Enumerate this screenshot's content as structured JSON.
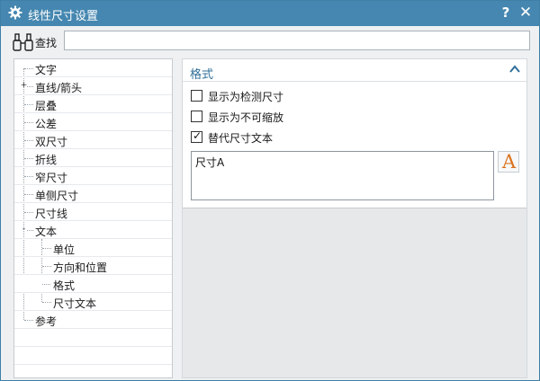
{
  "window": {
    "title": "线性尺寸设置",
    "help_label": "?",
    "close_label": "✕"
  },
  "search": {
    "label": "查找",
    "value": "",
    "placeholder": ""
  },
  "tree": {
    "items": [
      {
        "label": "文字",
        "level": 0
      },
      {
        "label": "直线/箭头",
        "level": 0,
        "expander": "+"
      },
      {
        "label": "层叠",
        "level": 0
      },
      {
        "label": "公差",
        "level": 0
      },
      {
        "label": "双尺寸",
        "level": 0
      },
      {
        "label": "折线",
        "level": 0
      },
      {
        "label": "窄尺寸",
        "level": 0
      },
      {
        "label": "单侧尺寸",
        "level": 0
      },
      {
        "label": "尺寸线",
        "level": 0
      },
      {
        "label": "文本",
        "level": 0,
        "expander": "-"
      },
      {
        "label": "单位",
        "level": 1
      },
      {
        "label": "方向和位置",
        "level": 1
      },
      {
        "label": "格式",
        "level": 1,
        "selected": true
      },
      {
        "label": "尺寸文本",
        "level": 1
      },
      {
        "label": "参考",
        "level": 0
      }
    ]
  },
  "format_group": {
    "title": "格式",
    "options": [
      {
        "label": "显示为检测尺寸",
        "checked": false
      },
      {
        "label": "显示为不可缩放",
        "checked": false
      },
      {
        "label": "替代尺寸文本",
        "checked": true
      }
    ],
    "override_text": "尺寸A",
    "font_button_glyph": "A"
  },
  "colors": {
    "titlebar": "#4587b0",
    "selection": "#a9cbdc",
    "group_title": "#2f6f99",
    "font_glyph": "#d9731f"
  }
}
